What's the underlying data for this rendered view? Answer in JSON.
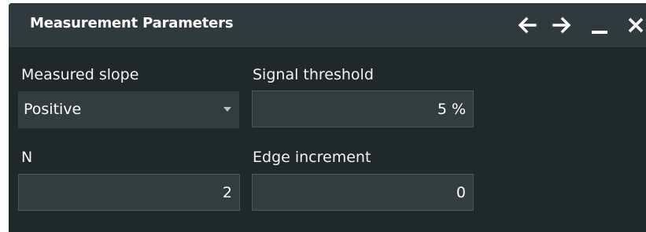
{
  "dialog": {
    "title": "Measurement Parameters",
    "controls": {
      "back_icon": "arrow-left-icon",
      "forward_icon": "arrow-right-icon",
      "minimize_icon": "minimize-icon",
      "close_icon": "close-icon"
    }
  },
  "fields": {
    "measured_slope": {
      "label": "Measured slope",
      "value": "Positive"
    },
    "signal_threshold": {
      "label": "Signal threshold",
      "value": "5 %"
    },
    "n": {
      "label": "N",
      "value": "2"
    },
    "edge_increment": {
      "label": "Edge increment",
      "value": "0"
    }
  },
  "colors": {
    "background": "#1f282b",
    "titlebar": "#2f3a3f",
    "field": "#323d42",
    "text": "#ffffff"
  }
}
